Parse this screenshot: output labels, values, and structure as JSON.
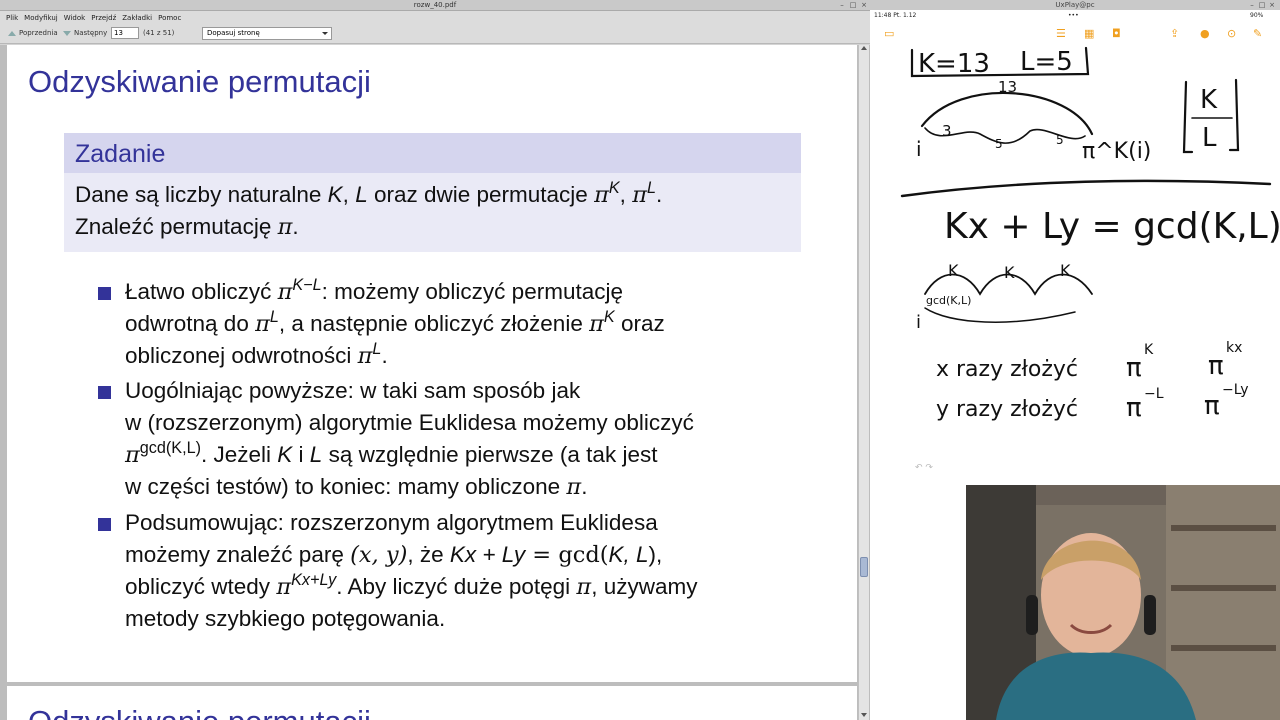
{
  "pdf_window": {
    "title": "rozw_40.pdf",
    "menu": [
      "Plik",
      "Modyfikuj",
      "Widok",
      "Przejdź",
      "Zakładki",
      "Pomoc"
    ],
    "toolbar": {
      "prev_label": "Poprzednia",
      "next_label": "Następny",
      "page_value": "13",
      "page_count": "(41 z 51)",
      "zoom_value": "Dopasuj stronę"
    }
  },
  "slide": {
    "title": "Odzyskiwanie permutacji",
    "block_title": "Zadanie",
    "block_line1_a": "Dane są liczby naturalne ",
    "block_line1_K": "K",
    "block_line1_b": ", ",
    "block_line1_L": "L",
    "block_line1_c": " oraz dwie permutacje ",
    "pi": "π",
    "sup_K": "K",
    "sup_L": "L",
    "block_line2": "Znaleźć permutację ",
    "b1_l1_a": "Łatwo obliczyć ",
    "sup_KmL": "K−L",
    "b1_l1_b": ": możemy obliczyć permutację",
    "b1_l2_a": "odwrotną do ",
    "b1_l2_b": ", a następnie obliczyć złożenie ",
    "b1_l2_c": " oraz",
    "b1_l3_a": "obliczonej odwrotności ",
    "b2_l1": "Uogólniając powyższe: w taki sam sposób jak",
    "b2_l2": "w (rozszerzonym) algorytmie Euklidesa możemy obliczyć",
    "sup_gcd": "gcd(K,L)",
    "b2_l3_a": ". Jeżeli ",
    "b2_l3_b": " i ",
    "b2_l3_c": " są względnie pierwsze (a tak jest",
    "b2_l4": "w części testów) to koniec: mamy obliczone ",
    "b3_l1": "Podsumowując: rozszerzonym algorytmem Euklidesa",
    "b3_l2_a": "możemy znaleźć parę ",
    "b3_l2_xy": "(x, y)",
    "b3_l2_b": ", że ",
    "b3_l2_expr": "Kx + Ly",
    "b3_l2_eq": " = gcd(",
    "b3_l2_KL": "K, L",
    "b3_l2_c": "),",
    "b3_l3_a": "obliczyć wtedy ",
    "sup_KxLy": "Kx+Ly",
    "b3_l3_b": ". Aby liczyć duże potęgi ",
    "b3_l3_c": ", używamy",
    "b3_l4": "metody szybkiego potęgowania.",
    "next_title": "Odzyskiwanie permutacji"
  },
  "notes_window": {
    "title": "UxPlay@pc",
    "status_time": "11:48  Pt. 1.12",
    "status_right": "90%",
    "undo_label": "↶  ↷",
    "handwriting": {
      "k_eq": "K=13",
      "l_eq": "L=5",
      "arc_13": "13",
      "i": "i",
      "n3": "3",
      "n5a": "5",
      "n5b": "5",
      "pi_k_i": "π^K(i)",
      "frac_K": "K",
      "frac_L": "L",
      "equation": "Kx + Ly = gcd(K,L)",
      "k1": "K",
      "k2": "K",
      "k3": "K",
      "gcd_label": "gcd(K,L)",
      "i2": "i",
      "x_line": "x razy złożyć",
      "y_line": "y razy złożyć",
      "pi_K": "π",
      "pi_K_sup": "K",
      "pi_L": "π",
      "pi_L_sup": "−L",
      "pi_kx": "π",
      "pi_kx_sup": "kx",
      "pi_ly": "π",
      "pi_ly_sup": "−Ly"
    }
  }
}
